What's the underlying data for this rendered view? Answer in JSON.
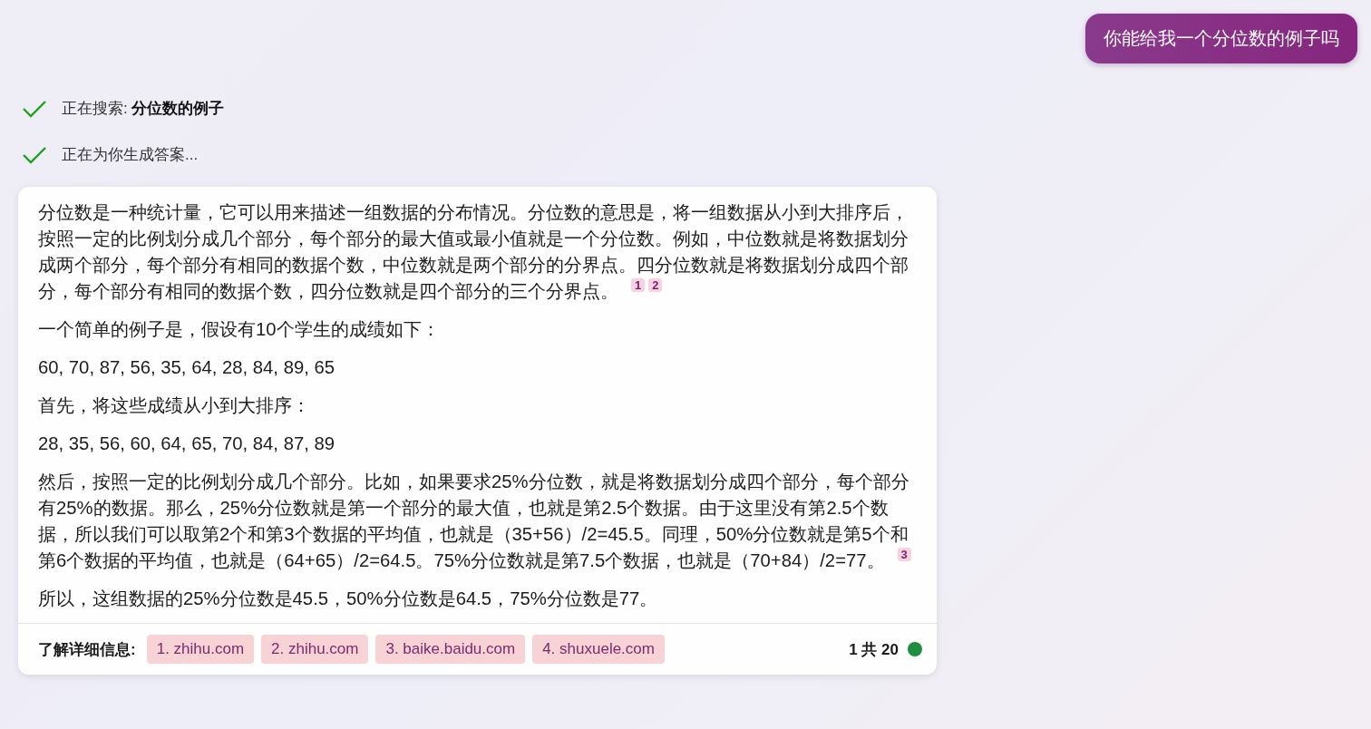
{
  "user_message": "你能给我一个分位数的例子吗",
  "steps": [
    {
      "text": "正在搜索: **分位数的例子**",
      "done": true
    },
    {
      "text": "正在为你生成答案...",
      "done": true
    }
  ],
  "answer": {
    "paragraphs": [
      {
        "text": "分位数是一种统计量，它可以用来描述一组数据的分布情况。分位数的意思是，将一组数据从小到大排序后，按照一定的比例划分成几个部分，每个部分的最大值或最小值就是一个分位数。例如，中位数就是将数据划分成两个部分，每个部分有相同的数据个数，中位数就是两个部分的分界点。四分位数就是将数据划分成四个部分，每个部分有相同的数据个数，四分位数就是四个部分的三个分界点。",
        "citations": [
          "1",
          "2"
        ]
      },
      {
        "text": "一个简单的例子是，假设有10个学生的成绩如下："
      },
      {
        "text": "60, 70, 87, 56, 35, 64, 28, 84, 89, 65"
      },
      {
        "text": "首先，将这些成绩从小到大排序："
      },
      {
        "text": "28, 35, 56, 60, 64, 65, 70, 84, 87, 89"
      },
      {
        "text": "然后，按照一定的比例划分成几个部分。比如，如果要求25%分位数，就是将数据划分成四个部分，每个部分有25%的数据。那么，25%分位数就是第一个部分的最大值，也就是第2.5个数据。由于这里没有第2.5个数据，所以我们可以取第2个和第3个数据的平均值，也就是（35+56）/2=45.5。同理，50%分位数就是第5个和第6个数据的平均值，也就是（64+65）/2=64.5。75%分位数就是第7.5个数据，也就是（70+84）/2=77。",
        "citations": [
          "3"
        ]
      },
      {
        "text": "所以，这组数据的25%分位数是45.5，50%分位数是64.5，75%分位数是77。"
      }
    ]
  },
  "learn_more": {
    "label": "了解详细信息:",
    "sources": [
      "1. zhihu.com",
      "2. zhihu.com",
      "3. baike.baidu.com",
      "4. shuxuele.com"
    ],
    "page_count": "1 共 20"
  }
}
